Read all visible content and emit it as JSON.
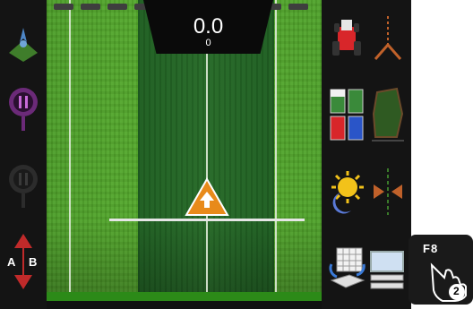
{
  "header": {
    "speed_value": "0.0",
    "secondary_value": "0"
  },
  "left_buttons": [
    {
      "icon": "guidance-map-icon"
    },
    {
      "icon": "pause-marker-icon"
    },
    {
      "icon": "marker-pin-icon"
    },
    {
      "icon": "ab-line-icon",
      "label_a": "A",
      "label_b": "B"
    }
  ],
  "right_buttons": [
    {
      "icon": "tractor-icon"
    },
    {
      "icon": "implement-icon"
    },
    {
      "icon": "section-color-icon"
    },
    {
      "icon": "field-boundary-icon"
    },
    {
      "icon": "day-night-icon"
    },
    {
      "icon": "nudge-icon"
    },
    {
      "icon": "grid-sync-icon"
    },
    {
      "icon": "screen-layout-icon"
    }
  ],
  "key_callout": {
    "label": "F8",
    "step": "2"
  },
  "colors": {
    "field_green": "#55aa2c",
    "swath_green": "#276a28",
    "vehicle_orange": "#e88a1a",
    "accent_lime": "#9bd83a"
  }
}
